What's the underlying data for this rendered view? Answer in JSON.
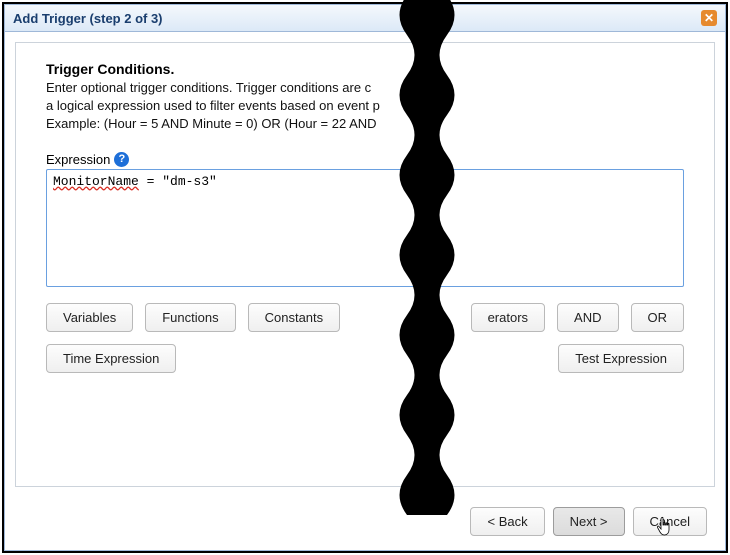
{
  "dialog": {
    "title": "Add Trigger (step 2 of 3)"
  },
  "section": {
    "heading": "Trigger Conditions.",
    "line1": "Enter optional trigger conditions. Trigger conditions are c",
    "line2": "a logical expression used to filter events based on event p",
    "line3": "Example: (Hour = 5 AND Minute = 0) OR (Hour = 22 AND "
  },
  "expression": {
    "label": "Expression",
    "value_identifier": "MonitorName",
    "value_rest": " = \"dm-s3\""
  },
  "buttons": {
    "variables": "Variables",
    "functions": "Functions",
    "constants": "Constants",
    "operators": "erators",
    "and": "AND",
    "or": "OR",
    "time_expression": "Time Expression",
    "test_expression": "Test Expression"
  },
  "footer": {
    "back": "< Back",
    "next": "Next >",
    "cancel": "Cancel"
  }
}
